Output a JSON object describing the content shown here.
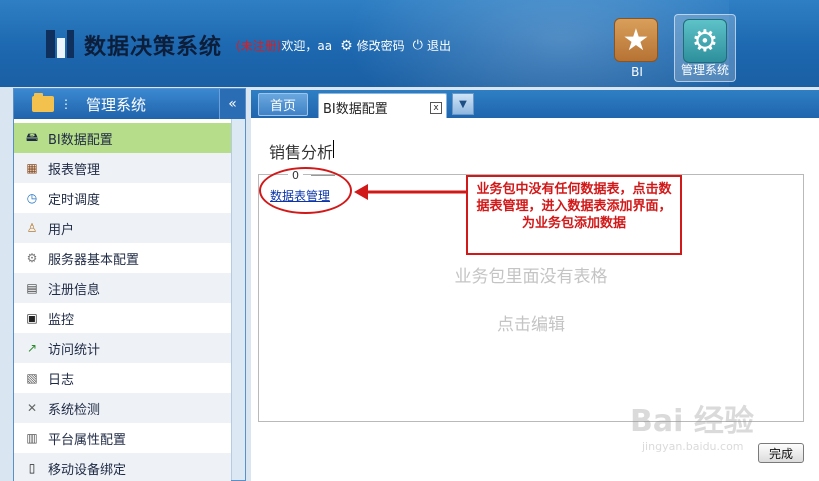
{
  "header": {
    "app_title": "数据决策系统",
    "unregistered": "(未注册)",
    "welcome": "欢迎，aa",
    "change_password": "修改密码",
    "logout": "退出",
    "buttons": {
      "bi": "BI",
      "admin": "管理系统"
    }
  },
  "sidebar": {
    "title": "管理系统",
    "collapse_glyph": "«",
    "items": [
      {
        "label": "BI数据配置",
        "icon": "database-icon",
        "glyph": "🖴",
        "active": true
      },
      {
        "label": "报表管理",
        "icon": "report-icon",
        "glyph": "▦"
      },
      {
        "label": "定时调度",
        "icon": "clock-icon",
        "glyph": "◷"
      },
      {
        "label": "用户",
        "icon": "user-icon",
        "glyph": "♙"
      },
      {
        "label": "服务器基本配置",
        "icon": "gear-icon",
        "glyph": "⚙"
      },
      {
        "label": "注册信息",
        "icon": "register-icon",
        "glyph": "▤"
      },
      {
        "label": "监控",
        "icon": "monitor-icon",
        "glyph": "▣"
      },
      {
        "label": "访问统计",
        "icon": "stats-icon",
        "glyph": "↗"
      },
      {
        "label": "日志",
        "icon": "log-icon",
        "glyph": "▧"
      },
      {
        "label": "系统检测",
        "icon": "tools-icon",
        "glyph": "✕"
      },
      {
        "label": "平台属性配置",
        "icon": "platform-icon",
        "glyph": "▥"
      },
      {
        "label": "移动设备绑定",
        "icon": "mobile-icon",
        "glyph": "▯"
      }
    ]
  },
  "tabs": {
    "home": "首页",
    "active": "BI数据配置",
    "close_glyph": "x",
    "dropdown_glyph": "▼"
  },
  "main": {
    "package_title": "销售分析",
    "count": "0",
    "datatable_link": "数据表管理",
    "empty_text": "业务包里面没有表格",
    "click_edit": "点击编辑",
    "done_button": "完成"
  },
  "annotation": {
    "text": "业务包中没有任何数据表，点击数据表管理，进入数据表添加界面，为业务包添加数据",
    "color": "#d21919"
  },
  "watermark": {
    "line1": "Bai 经验",
    "line2": "jingyan.baidu.com"
  },
  "colors": {
    "header_blue": "#1d68b0",
    "active_item": "#b6dd8a",
    "link": "#0b35a8"
  }
}
